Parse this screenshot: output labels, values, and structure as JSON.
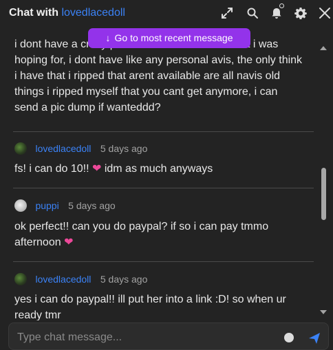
{
  "header": {
    "title_prefix": "Chat with",
    "title_user": "lovedlacedoll"
  },
  "banner": {
    "label": "Go to most recent message"
  },
  "messages": [
    {
      "text": "i dont have a crazy price but 5-10 dollars is what i was hoping for, i dont have like any personal avis, the only think i have that i ripped that arent available are all navis old things i ripped myself that you cant get anymore, i can send a pic dump if wanteddd?"
    },
    {
      "author": "lovedlacedoll",
      "time": "5 days ago",
      "text": "fs! i can do 10!!",
      "text_after": "idm as much anyways",
      "emoji": "❤"
    },
    {
      "author": "puppi",
      "time": "5 days ago",
      "text": "ok perfect!! can you do paypal? if so i can pay tmmo afternoon",
      "emoji": "❤"
    },
    {
      "author": "lovedlacedoll",
      "time": "5 days ago",
      "text": "yes i can do paypal!! ill put her into a link :D! so when ur ready tmr"
    }
  ],
  "composer": {
    "placeholder": "Type chat message..."
  },
  "icons": {
    "expand": "expand-icon",
    "search": "search-icon",
    "bell": "bell-icon",
    "settings": "gear-icon",
    "close": "close-icon",
    "emoji": "emoji-icon",
    "send": "send-icon"
  },
  "colors": {
    "background": "#232323",
    "accent_button": "#9333ea",
    "username": "#3b82f6",
    "heart": "#ec4899",
    "send": "#3b82f6"
  }
}
